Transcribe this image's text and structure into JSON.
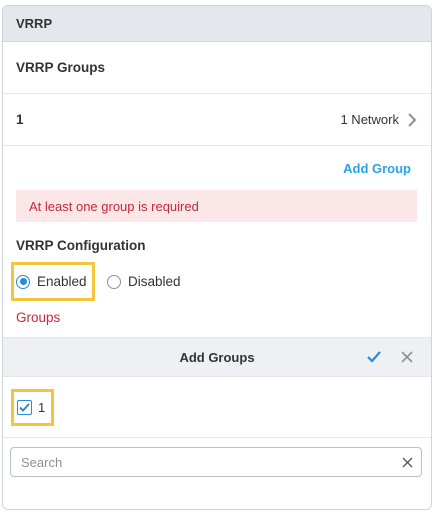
{
  "panel": {
    "title": "VRRP"
  },
  "groups_section": {
    "title": "VRRP Groups"
  },
  "group_row": {
    "id": "1",
    "network_label": "1 Network"
  },
  "add_group": {
    "label": "Add Group"
  },
  "error": {
    "message": "At least one group is required"
  },
  "config": {
    "title": "VRRP Configuration",
    "options": [
      {
        "label": "Enabled",
        "selected": true
      },
      {
        "label": "Disabled",
        "selected": false
      }
    ],
    "groups_label": "Groups"
  },
  "add_groups_dialog": {
    "title": "Add Groups",
    "items": [
      {
        "label": "1",
        "checked": true
      }
    ],
    "search": {
      "placeholder": "Search",
      "value": ""
    }
  },
  "colors": {
    "accent": "#2a8ad8",
    "link": "#2aa3e6",
    "error_text": "#c8283a",
    "error_bg": "#fbe6e8",
    "highlight": "#f2c53d"
  }
}
